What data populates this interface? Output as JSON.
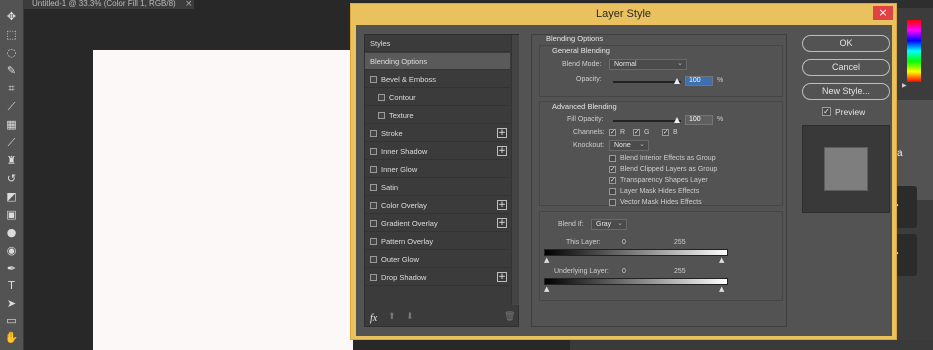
{
  "photoshop": {
    "document_tab": "Untitled-1 @ 33.3% (Color Fill 1, RGB/8)",
    "tools": [
      "move-icon",
      "marquee-icon",
      "lasso-icon",
      "quick-select-icon",
      "crop-icon",
      "eyedropper-icon",
      "healing-icon",
      "brush-icon",
      "stamp-icon",
      "history-brush-icon",
      "eraser-icon",
      "gradient-icon",
      "blur-icon",
      "dodge-icon",
      "pen-icon",
      "type-icon",
      "path-select-icon",
      "shape-icon",
      "hand-icon"
    ],
    "right_panel_letter": "a"
  },
  "dialog": {
    "title": "Layer Style",
    "close": "×",
    "styles_header": "Styles",
    "styles": [
      {
        "label": "Blending Options",
        "checkbox": false,
        "plus": false,
        "selected": true
      },
      {
        "label": "Bevel & Emboss",
        "checkbox": true,
        "plus": false
      },
      {
        "label": "Contour",
        "checkbox": true,
        "plus": false,
        "indent": true
      },
      {
        "label": "Texture",
        "checkbox": true,
        "plus": false,
        "indent": true
      },
      {
        "label": "Stroke",
        "checkbox": true,
        "plus": true
      },
      {
        "label": "Inner Shadow",
        "checkbox": true,
        "plus": true
      },
      {
        "label": "Inner Glow",
        "checkbox": true,
        "plus": false
      },
      {
        "label": "Satin",
        "checkbox": true,
        "plus": false
      },
      {
        "label": "Color Overlay",
        "checkbox": true,
        "plus": true
      },
      {
        "label": "Gradient Overlay",
        "checkbox": true,
        "plus": true
      },
      {
        "label": "Pattern Overlay",
        "checkbox": true,
        "plus": false
      },
      {
        "label": "Outer Glow",
        "checkbox": true,
        "plus": false
      },
      {
        "label": "Drop Shadow",
        "checkbox": true,
        "plus": true
      }
    ],
    "footer": {
      "fx": "fx"
    },
    "blending": {
      "section_title": "Blending Options",
      "general_title": "General Blending",
      "blend_mode_label": "Blend Mode:",
      "blend_mode_value": "Normal",
      "opacity_label": "Opacity:",
      "opacity_value": "100",
      "opacity_unit": "%",
      "advanced_title": "Advanced Blending",
      "fill_opacity_label": "Fill Opacity:",
      "fill_opacity_value": "100",
      "fill_opacity_unit": "%",
      "channels_label": "Channels:",
      "channels": [
        "R",
        "G",
        "B"
      ],
      "knockout_label": "Knockout:",
      "knockout_value": "None",
      "options": [
        {
          "label": "Blend Interior Effects as Group",
          "checked": false
        },
        {
          "label": "Blend Clipped Layers as Group",
          "checked": true
        },
        {
          "label": "Transparency Shapes Layer",
          "checked": true
        },
        {
          "label": "Layer Mask Hides Effects",
          "checked": false
        },
        {
          "label": "Vector Mask Hides Effects",
          "checked": false
        }
      ],
      "blend_if_label": "Blend If:",
      "blend_if_value": "Gray",
      "this_layer_label": "This Layer:",
      "this_layer_min": "0",
      "this_layer_max": "255",
      "underlying_label": "Underlying Layer:",
      "underlying_min": "0",
      "underlying_max": "255"
    },
    "buttons": {
      "ok": "OK",
      "cancel": "Cancel",
      "new_style": "New Style..."
    },
    "preview_label": "Preview",
    "check": "✓"
  }
}
